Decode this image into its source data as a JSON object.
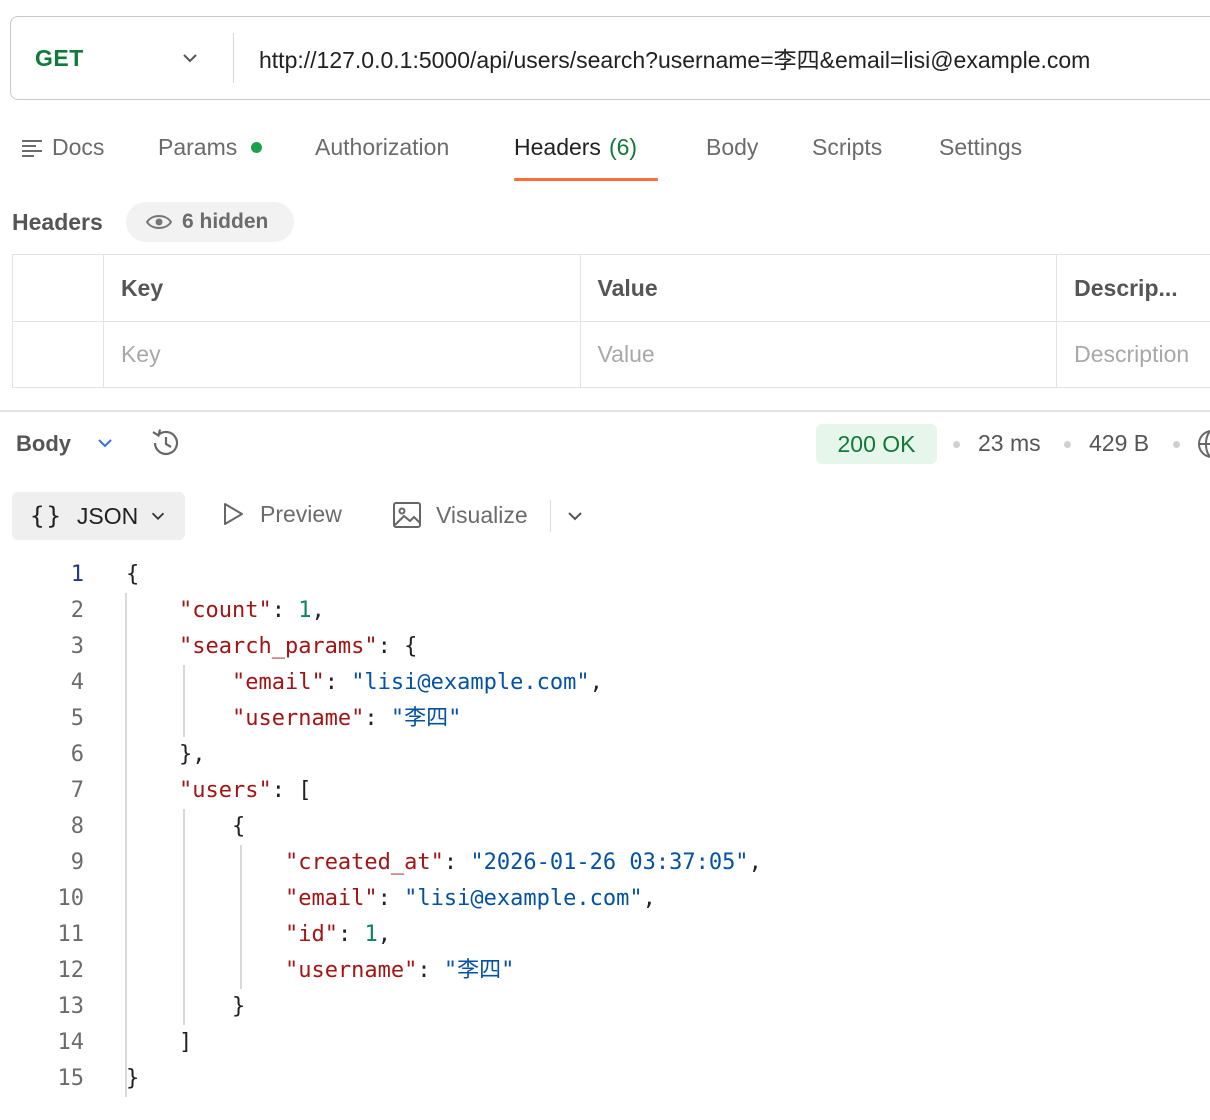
{
  "request": {
    "method": "GET",
    "url": "http://127.0.0.1:5000/api/users/search?username=李四&email=lisi@example.com"
  },
  "tabs": {
    "docs": "Docs",
    "params": "Params",
    "authorization": "Authorization",
    "headers": "Headers",
    "headers_count": "(6)",
    "body": "Body",
    "scripts": "Scripts",
    "settings": "Settings"
  },
  "headers_section": {
    "title": "Headers",
    "hidden_label": "6 hidden",
    "columns": [
      "Key",
      "Value",
      "Descrip..."
    ],
    "placeholders": [
      "Key",
      "Value",
      "Description"
    ]
  },
  "response": {
    "body_label": "Body",
    "status": "200 OK",
    "time": "23 ms",
    "size": "429 B"
  },
  "view_toolbar": {
    "json": "JSON",
    "preview": "Preview",
    "visualize": "Visualize"
  },
  "code_lines": [
    {
      "n": "1"
    },
    {
      "n": "2"
    },
    {
      "n": "3"
    },
    {
      "n": "4"
    },
    {
      "n": "5"
    },
    {
      "n": "6"
    },
    {
      "n": "7"
    },
    {
      "n": "8"
    },
    {
      "n": "9"
    },
    {
      "n": "10"
    },
    {
      "n": "11"
    },
    {
      "n": "12"
    },
    {
      "n": "13"
    },
    {
      "n": "14"
    },
    {
      "n": "15"
    }
  ],
  "json_body": {
    "count_key": "\"count\"",
    "count_val": "1",
    "search_params_key": "\"search_params\"",
    "sp_email_key": "\"email\"",
    "sp_email_val": "\"lisi@example.com\"",
    "sp_username_key": "\"username\"",
    "sp_username_val": "\"李四\"",
    "users_key": "\"users\"",
    "created_at_key": "\"created_at\"",
    "created_at_val": "\"2026-01-26 03:37:05\"",
    "email_key": "\"email\"",
    "email_val": "\"lisi@example.com\"",
    "id_key": "\"id\"",
    "id_val": "1",
    "username_key": "\"username\"",
    "username_val": "\"李四\""
  },
  "colors": {
    "accent": "#ff6c37",
    "method_green": "#0f7a3a",
    "json_key": "#a31515",
    "json_string": "#0451a5",
    "json_number": "#098658"
  }
}
